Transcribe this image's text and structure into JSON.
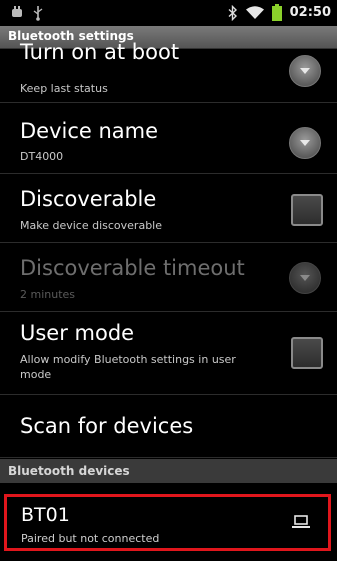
{
  "status_bar": {
    "time": "02:50",
    "icons": [
      "usb-debug-icon",
      "usb-icon",
      "bluetooth-icon",
      "wifi-icon",
      "battery-icon"
    ]
  },
  "header": {
    "title": "Bluetooth settings"
  },
  "settings": {
    "turn_on_at_boot": {
      "title": "Turn on at boot",
      "subtitle": "Keep last status"
    },
    "device_name": {
      "title": "Device name",
      "subtitle": "DT4000"
    },
    "discoverable": {
      "title": "Discoverable",
      "subtitle": "Make device discoverable",
      "checked": false
    },
    "discoverable_timeout": {
      "title": "Discoverable timeout",
      "subtitle": "2 minutes",
      "enabled": false
    },
    "user_mode": {
      "title": "User mode",
      "subtitle": "Allow modify Bluetooth settings in user mode",
      "checked": false
    },
    "scan": {
      "title": "Scan for devices"
    }
  },
  "devices_section": {
    "title": "Bluetooth devices"
  },
  "devices": [
    {
      "name": "BT01",
      "status": "Paired but not connected",
      "icon": "laptop-icon"
    }
  ],
  "colors": {
    "highlight_border": "#e0161c",
    "battery": "#8bd12b"
  }
}
